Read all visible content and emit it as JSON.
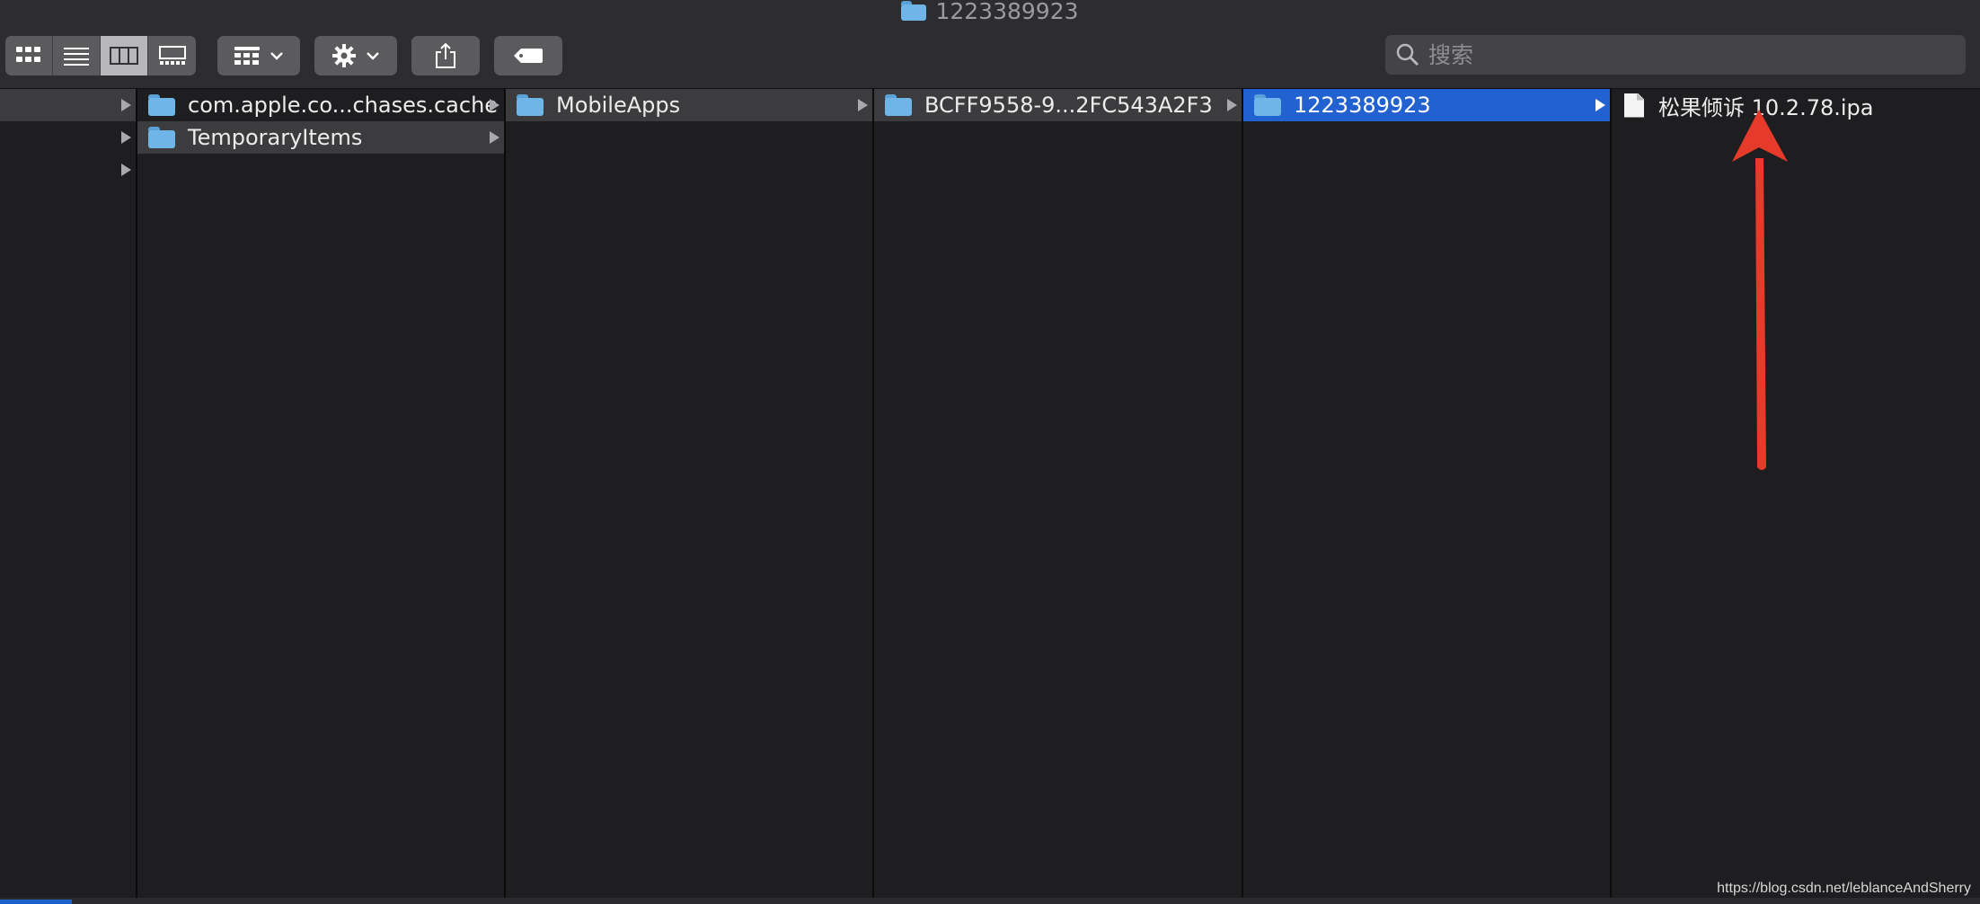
{
  "window": {
    "title": "1223389923"
  },
  "toolbar": {
    "view_buttons": [
      {
        "name": "icon-view",
        "icon": "grid-icon"
      },
      {
        "name": "list-view",
        "icon": "list-icon"
      },
      {
        "name": "column-view",
        "icon": "columns-icon",
        "active": true
      },
      {
        "name": "gallery-view",
        "icon": "gallery-icon"
      }
    ],
    "group_icon": "grid-group-icon",
    "action_icon": "gear-icon",
    "share_icon": "share-icon",
    "tag_icon": "tag-icon",
    "dropdown_icon": "chevron-down-icon"
  },
  "search": {
    "placeholder": "搜索",
    "value": ""
  },
  "columns": [
    {
      "items": [
        {
          "label": "",
          "highlighted": true,
          "has_arrow": true
        },
        {
          "label": "",
          "has_arrow": true
        },
        {
          "label": "",
          "has_arrow": true
        }
      ]
    },
    {
      "items": [
        {
          "label": "com.apple.co...chases.cache",
          "icon": "folder-icon",
          "has_arrow": true
        },
        {
          "label": "TemporaryItems",
          "icon": "folder-icon",
          "highlighted": true,
          "has_arrow": true
        }
      ]
    },
    {
      "items": [
        {
          "label": "MobileApps",
          "icon": "folder-icon",
          "highlighted": true,
          "has_arrow": true
        }
      ]
    },
    {
      "items": [
        {
          "label": "BCFF9558-9...2FC543A2F3",
          "icon": "folder-icon",
          "highlighted": true,
          "has_arrow": true
        }
      ]
    },
    {
      "items": [
        {
          "label": "1223389923",
          "icon": "folder-icon",
          "selected": true,
          "has_arrow": true
        }
      ]
    },
    {
      "items": [
        {
          "label": "松果倾诉 10.2.78.ipa",
          "icon": "document-icon",
          "has_arrow": false
        }
      ]
    }
  ],
  "annotation": {
    "color": "#e63b2a"
  },
  "watermark": "https://blog.csdn.net/leblanceAndSherry",
  "colors": {
    "selection": "#2262d0",
    "folder": "#6fb5e7",
    "background": "#1e1e20"
  }
}
